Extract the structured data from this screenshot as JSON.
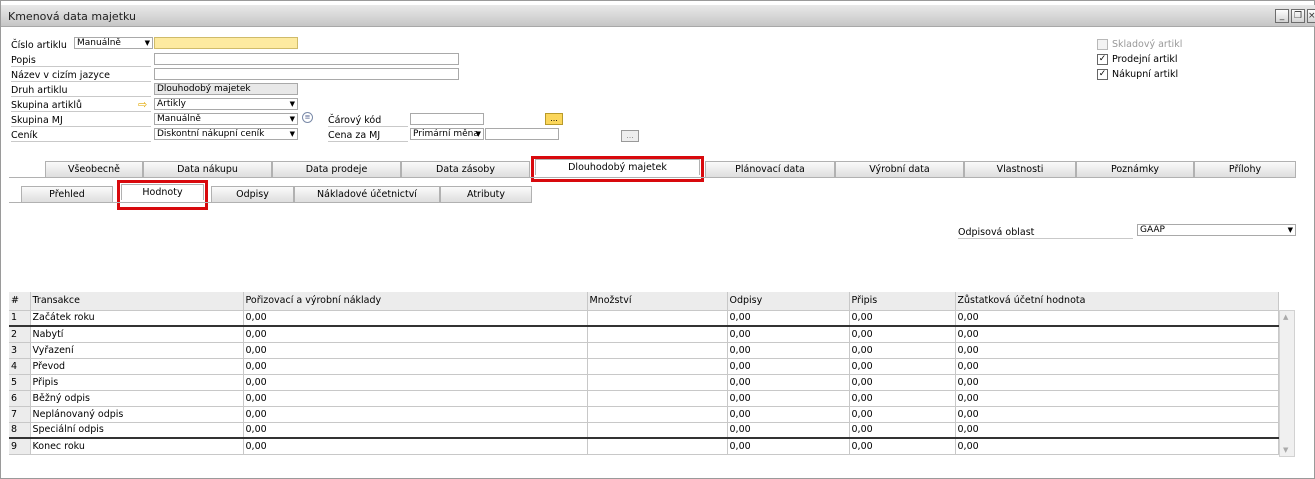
{
  "window": {
    "title": "Kmenová data majetku"
  },
  "header_fields": {
    "item_no_label": "Číslo artiklu",
    "item_no_mode": "Manuálně",
    "description_label": "Popis",
    "foreign_name_label": "Název v cizím jazyce",
    "item_type_label": "Druh artiklu",
    "item_type_value": "Dlouhodobý majetek",
    "item_group_label": "Skupina artiklů",
    "item_group_value": "Artikly",
    "uom_group_label": "Skupina MJ",
    "uom_group_value": "Manuálně",
    "price_list_label": "Ceník",
    "price_list_value": "Diskontní nákupní ceník",
    "barcode_label": "Čárový kód",
    "unit_price_label": "Cena za MJ",
    "currency_value": "Primární měna",
    "more_button": "..."
  },
  "checkboxes": [
    {
      "label": "Skladový artikl",
      "checked": false,
      "disabled": true
    },
    {
      "label": "Prodejní artikl",
      "checked": true,
      "disabled": false
    },
    {
      "label": "Nákupní artikl",
      "checked": true,
      "disabled": false
    }
  ],
  "main_tabs": [
    "Všeobecně",
    "Data nákupu",
    "Data prodeje",
    "Data zásoby",
    "Dlouhodobý majetek",
    "Plánovací data",
    "Výrobní data",
    "Vlastnosti",
    "Poznámky",
    "Přílohy"
  ],
  "sub_tabs": [
    "Přehled",
    "Hodnoty",
    "Odpisy",
    "Nákladové účetnictví",
    "Atributy"
  ],
  "depreciation_area": {
    "label": "Odpisová oblast",
    "value": "GAAP"
  },
  "table": {
    "headers": [
      "#",
      "Transakce",
      "Pořizovací a výrobní náklady",
      "Množství",
      "Odpisy",
      "Připis",
      "Zůstatková účetní hodnota"
    ],
    "rows": [
      [
        "1",
        "Začátek roku",
        "0,00",
        "",
        "0,00",
        "0,00",
        "0,00"
      ],
      [
        "2",
        "Nabytí",
        "0,00",
        "",
        "0,00",
        "0,00",
        "0,00"
      ],
      [
        "3",
        "Vyřazení",
        "0,00",
        "",
        "0,00",
        "0,00",
        "0,00"
      ],
      [
        "4",
        "Převod",
        "0,00",
        "",
        "0,00",
        "0,00",
        "0,00"
      ],
      [
        "5",
        "Připis",
        "0,00",
        "",
        "0,00",
        "0,00",
        "0,00"
      ],
      [
        "6",
        "Běžný odpis",
        "0,00",
        "",
        "0,00",
        "0,00",
        "0,00"
      ],
      [
        "7",
        "Neplánovaný odpis",
        "0,00",
        "",
        "0,00",
        "0,00",
        "0,00"
      ],
      [
        "8",
        "Speciální odpis",
        "0,00",
        "",
        "0,00",
        "0,00",
        "0,00"
      ],
      [
        "9",
        "Konec roku",
        "0,00",
        "",
        "0,00",
        "0,00",
        "0,00"
      ]
    ]
  }
}
